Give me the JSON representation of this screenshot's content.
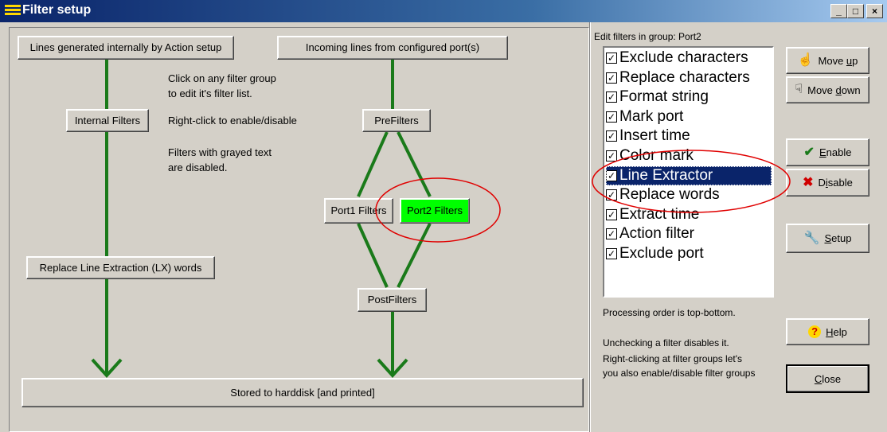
{
  "window": {
    "title": "Filter setup",
    "minimize_icon": "minimize-icon",
    "maximize_icon": "maximize-icon",
    "close_icon": "close-icon"
  },
  "flow": {
    "source_internal": "Lines generated internally by Action setup",
    "source_incoming": "Incoming lines from configured port(s)",
    "internal_filters": "Internal Filters",
    "prefilters": "PreFilters",
    "port1_filters": "Port1 Filters",
    "port2_filters": "Port2 Filters",
    "replace_lx": "Replace Line Extraction (LX) words",
    "postfilters": "PostFilters",
    "stored": "Stored to harddisk [and printed]",
    "note1_line1": "Click on any filter group",
    "note1_line2": "to edit it's filter list.",
    "note2": "Right-click to enable/disable",
    "note3_line1": "Filters with grayed text",
    "note3_line2": "are disabled.",
    "line_color": "#1a7a1a",
    "selected_color": "#00ff00",
    "annotation_color": "#e00000"
  },
  "editor": {
    "group_caption": "Edit filters in group: Port2",
    "filters": [
      {
        "label": "Exclude characters",
        "checked": true
      },
      {
        "label": "Replace characters",
        "checked": true
      },
      {
        "label": "Format string",
        "checked": true
      },
      {
        "label": "Mark port",
        "checked": true
      },
      {
        "label": "Insert time",
        "checked": true
      },
      {
        "label": "Color mark",
        "checked": true
      },
      {
        "label": "Line Extractor",
        "checked": true,
        "selected": true
      },
      {
        "label": "Replace words",
        "checked": true
      },
      {
        "label": "Extract time",
        "checked": true
      },
      {
        "label": "Action filter",
        "checked": true
      },
      {
        "label": "Exclude port",
        "checked": true
      }
    ],
    "processing_order": "Processing order is top-bottom.",
    "info1": "Unchecking a filter disables it.",
    "info2_line1": "Right-clicking at filter groups let's",
    "info2_line2": "you also enable/disable filter groups"
  },
  "buttons": {
    "move_up": {
      "pre": "Move ",
      "key": "u",
      "post": "p",
      "icon": "hand-up-icon"
    },
    "move_down": {
      "pre": "Move ",
      "key": "d",
      "post": "own",
      "icon": "hand-down-icon"
    },
    "enable": {
      "pre": "",
      "key": "E",
      "post": "nable",
      "icon": "checkmark-icon"
    },
    "disable": {
      "pre": "D",
      "key": "i",
      "post": "sable",
      "icon": "x-mark-icon"
    },
    "setup": {
      "pre": "",
      "key": "S",
      "post": "etup",
      "icon": "wrench-icon"
    },
    "help": {
      "pre": "",
      "key": "H",
      "post": "elp",
      "icon": "help-icon"
    },
    "close": {
      "pre": "",
      "key": "C",
      "post": "lose"
    }
  }
}
